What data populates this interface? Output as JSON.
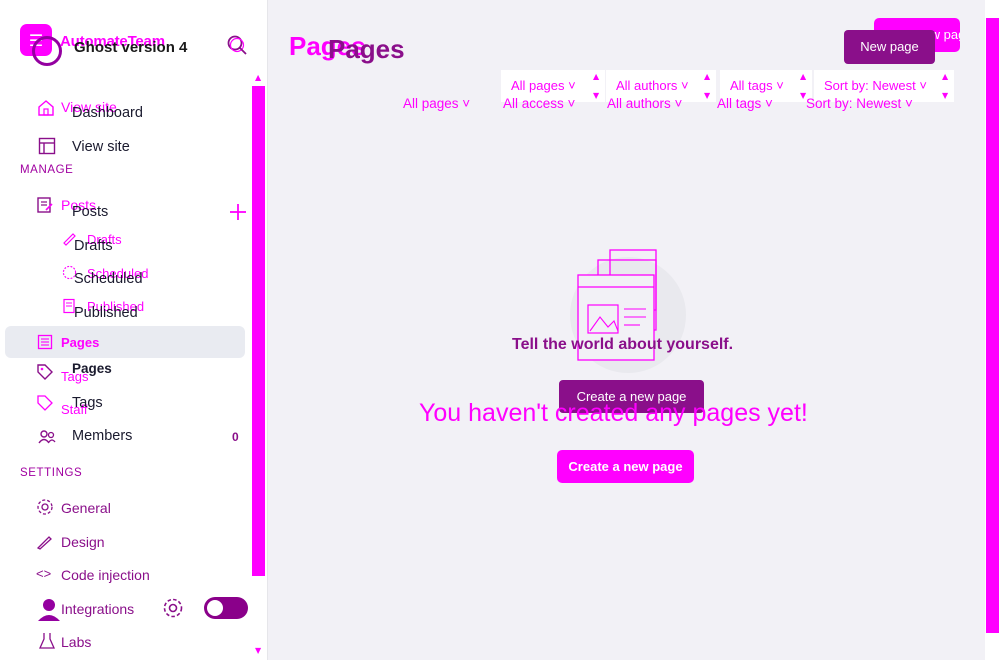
{
  "brand": {
    "ghost_title": "AutomateTeam",
    "title": "Ghost version 4"
  },
  "nav": {
    "ghost_view_site": "View site",
    "dashboard": "Dashboard",
    "view_site": "View site",
    "manage_label": "MANAGE",
    "ghost_posts": "Posts",
    "posts": "Posts",
    "ghost_drafts": "Drafts",
    "drafts": "Drafts",
    "ghost_scheduled": "Scheduled",
    "scheduled": "Scheduled",
    "ghost_published": "Published",
    "published": "Published",
    "pages_active": "Pages",
    "ghost_tags": "Tags",
    "pages": "Pages",
    "ghost_staff": "Staff",
    "tags": "Tags",
    "members": "Members",
    "members_count": "0",
    "settings_label": "SETTINGS",
    "general": "General",
    "design": "Design",
    "code_injection": "Code injection",
    "integrations": "Integrations",
    "labs": "Labs"
  },
  "header": {
    "ghost_title": "Pages",
    "title": "Pages",
    "ghost_new_page": "New page",
    "new_page": "New page"
  },
  "filters": {
    "ghost": [
      "All pages",
      "All authors",
      "All tags",
      "Sort by: Newest"
    ],
    "real": [
      "All pages",
      "All access",
      "All authors",
      "All tags",
      "Sort by: Newest"
    ]
  },
  "empty": {
    "heading": "Tell the world about yourself.",
    "button1": "Create a new page",
    "big_text": "You haven't created any pages yet!",
    "button2": "Create a new page"
  },
  "colors": {
    "accent": "#ff00ff",
    "accent_dark": "#8a0f8a",
    "background": "#f2f1f6"
  }
}
